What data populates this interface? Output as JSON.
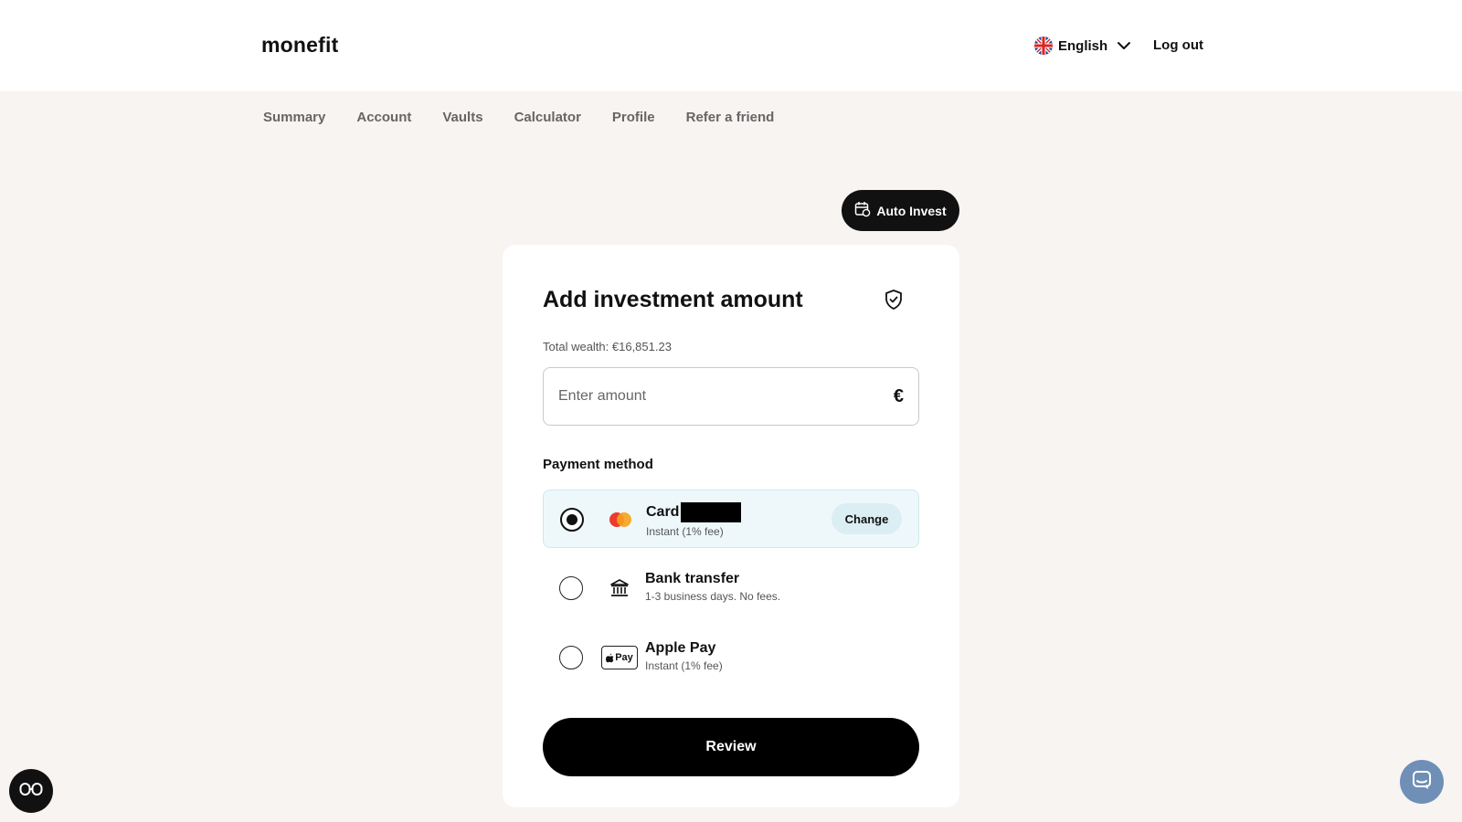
{
  "header": {
    "logo": "monefit",
    "language": "English",
    "logout": "Log out"
  },
  "nav": {
    "items": [
      "Summary",
      "Account",
      "Vaults",
      "Calculator",
      "Profile",
      "Refer a friend"
    ]
  },
  "auto_invest": {
    "label": "Auto Invest"
  },
  "panel": {
    "title": "Add investment amount",
    "wealth": "Total wealth: €16,851.23",
    "amount": {
      "placeholder": "Enter amount",
      "value": "",
      "currency": "€"
    },
    "payment_label": "Payment method",
    "payment_methods": [
      {
        "name": "Card",
        "sub": "Instant (1% fee)",
        "selected": true,
        "action": "Change",
        "icon": "mastercard-icon"
      },
      {
        "name": "Bank transfer",
        "sub": "1-3 business days. No fees.",
        "selected": false,
        "icon": "bank-icon"
      },
      {
        "name": "Apple Pay",
        "sub": "Instant (1% fee)",
        "selected": false,
        "icon": "apple-pay-icon",
        "badge": "Pay"
      }
    ],
    "review": "Review"
  },
  "colors": {
    "background": "#f7f4f2",
    "selected_option": "#eef8fb",
    "primary": "#000000",
    "chat": "#6f8fb6"
  }
}
